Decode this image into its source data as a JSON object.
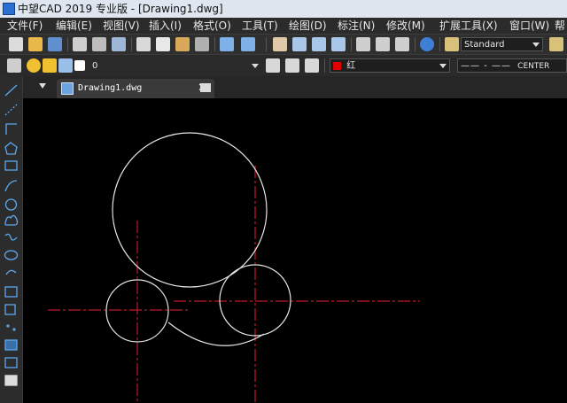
{
  "window": {
    "title": "中望CAD 2019 专业版 - [Drawing1.dwg]"
  },
  "menubar": {
    "items": [
      "文件(F)",
      "编辑(E)",
      "视图(V)",
      "插入(I)",
      "格式(O)",
      "工具(T)",
      "绘图(D)",
      "标注(N)",
      "修改(M)",
      "扩展工具(X)",
      "窗口(W)",
      "帮"
    ]
  },
  "toolbar": {
    "text_style": "Standard",
    "layer": "0",
    "color": "红",
    "linetype": "CENTER",
    "colors": {
      "layer_color_swatch": "#ffffff",
      "red_swatch": "#e00000",
      "help_icon": "#3f7fd6"
    }
  },
  "tabs": [
    {
      "label": "Drawing1.dwg"
    }
  ],
  "canvas": {
    "background": "#000000",
    "geometry_color": "#e6e6e6",
    "centerline_color": "#c0182b"
  }
}
